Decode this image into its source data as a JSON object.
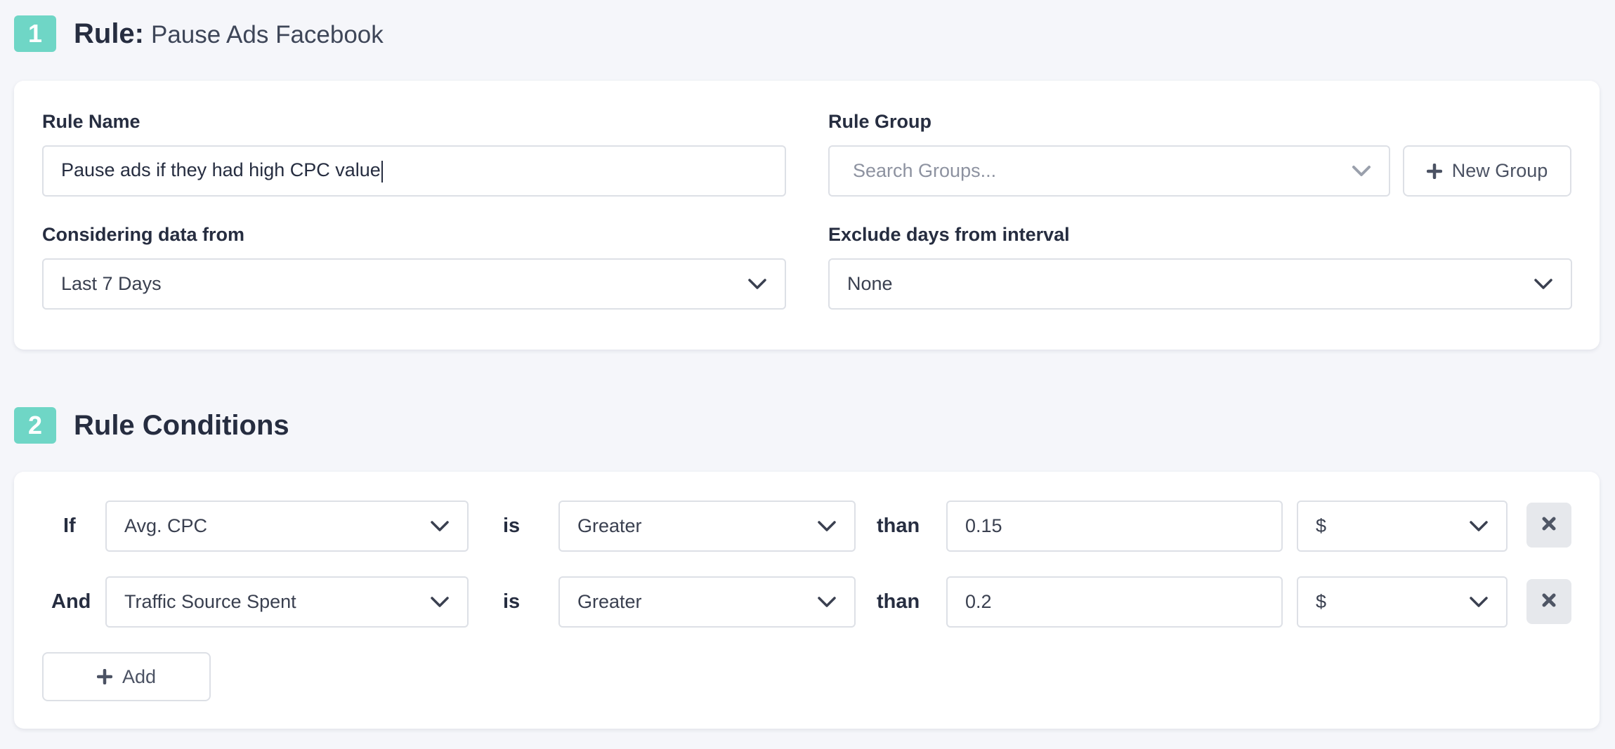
{
  "section1": {
    "number": "1",
    "title": "Rule:",
    "subtitle": "Pause Ads Facebook"
  },
  "rule_form": {
    "rule_name_label": "Rule Name",
    "rule_name_value": "Pause ads if they had high CPC value",
    "rule_group_label": "Rule Group",
    "rule_group_placeholder": "Search Groups...",
    "new_group_label": "New Group",
    "considering_label": "Considering data from",
    "considering_value": "Last 7 Days",
    "exclude_label": "Exclude days from interval",
    "exclude_value": "None"
  },
  "section2": {
    "number": "2",
    "title": "Rule Conditions"
  },
  "conditions": [
    {
      "connector": "If",
      "metric": "Avg. CPC",
      "is_label": "is",
      "operator": "Greater",
      "than_label": "than",
      "value": "0.15",
      "unit": "$"
    },
    {
      "connector": "And",
      "metric": "Traffic Source Spent",
      "is_label": "is",
      "operator": "Greater",
      "than_label": "than",
      "value": "0.2",
      "unit": "$"
    }
  ],
  "add_button_label": "Add",
  "icons": {
    "dropdown": "chevron-down-icon",
    "plus": "plus-icon",
    "remove": "close-icon"
  },
  "colors": {
    "badge": "#6fd6c6",
    "background": "#f5f6fa",
    "border": "#dde0e6"
  }
}
